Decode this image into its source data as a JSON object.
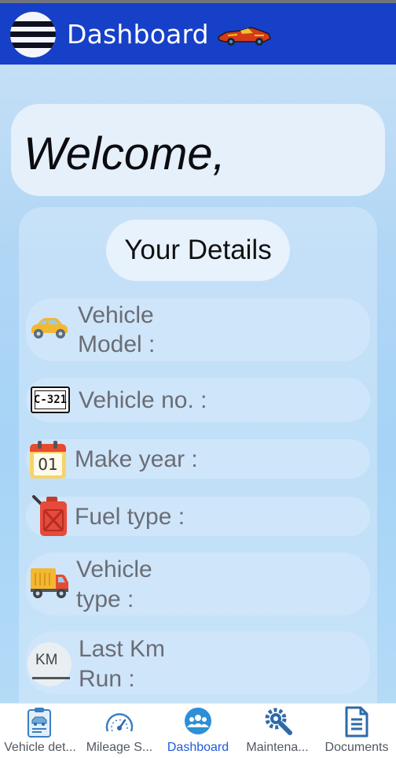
{
  "appbar": {
    "title": "Dashboard",
    "menu_icon": "hamburger-menu-icon",
    "logo_icon": "race-car-logo"
  },
  "welcome": {
    "text": "Welcome,"
  },
  "details": {
    "title": "Your Details",
    "rows": [
      {
        "icon": "car-icon",
        "label_line1": "Vehicle",
        "label_line2": "Model :"
      },
      {
        "icon": "license-plate-icon",
        "label": "Vehicle no. :",
        "plate_text": "C-321"
      },
      {
        "icon": "calendar-icon",
        "label": "Make year :",
        "calendar_text": "01"
      },
      {
        "icon": "fuel-can-icon",
        "label": "Fuel type :"
      },
      {
        "icon": "truck-icon",
        "label_line1": "Vehicle",
        "label_line2": "type :"
      },
      {
        "icon": "odometer-km-icon",
        "label_line1": "Last Km",
        "label_line2": "Run :",
        "km_text": "KM"
      }
    ]
  },
  "bottom_nav": {
    "active_index": 2,
    "items": [
      {
        "label": "Vehicle det...",
        "icon": "vehicle-details-icon"
      },
      {
        "label": "Mileage S...",
        "icon": "speedometer-icon"
      },
      {
        "label": "Dashboard",
        "icon": "group-icon"
      },
      {
        "label": "Maintena...",
        "icon": "wrench-gear-icon"
      },
      {
        "label": "Documents",
        "icon": "document-icon"
      }
    ]
  },
  "colors": {
    "appbar": "#1640c8",
    "active_nav": "#1f5bd6",
    "card": "#e5f0fb",
    "row": "#cfe5fa"
  }
}
